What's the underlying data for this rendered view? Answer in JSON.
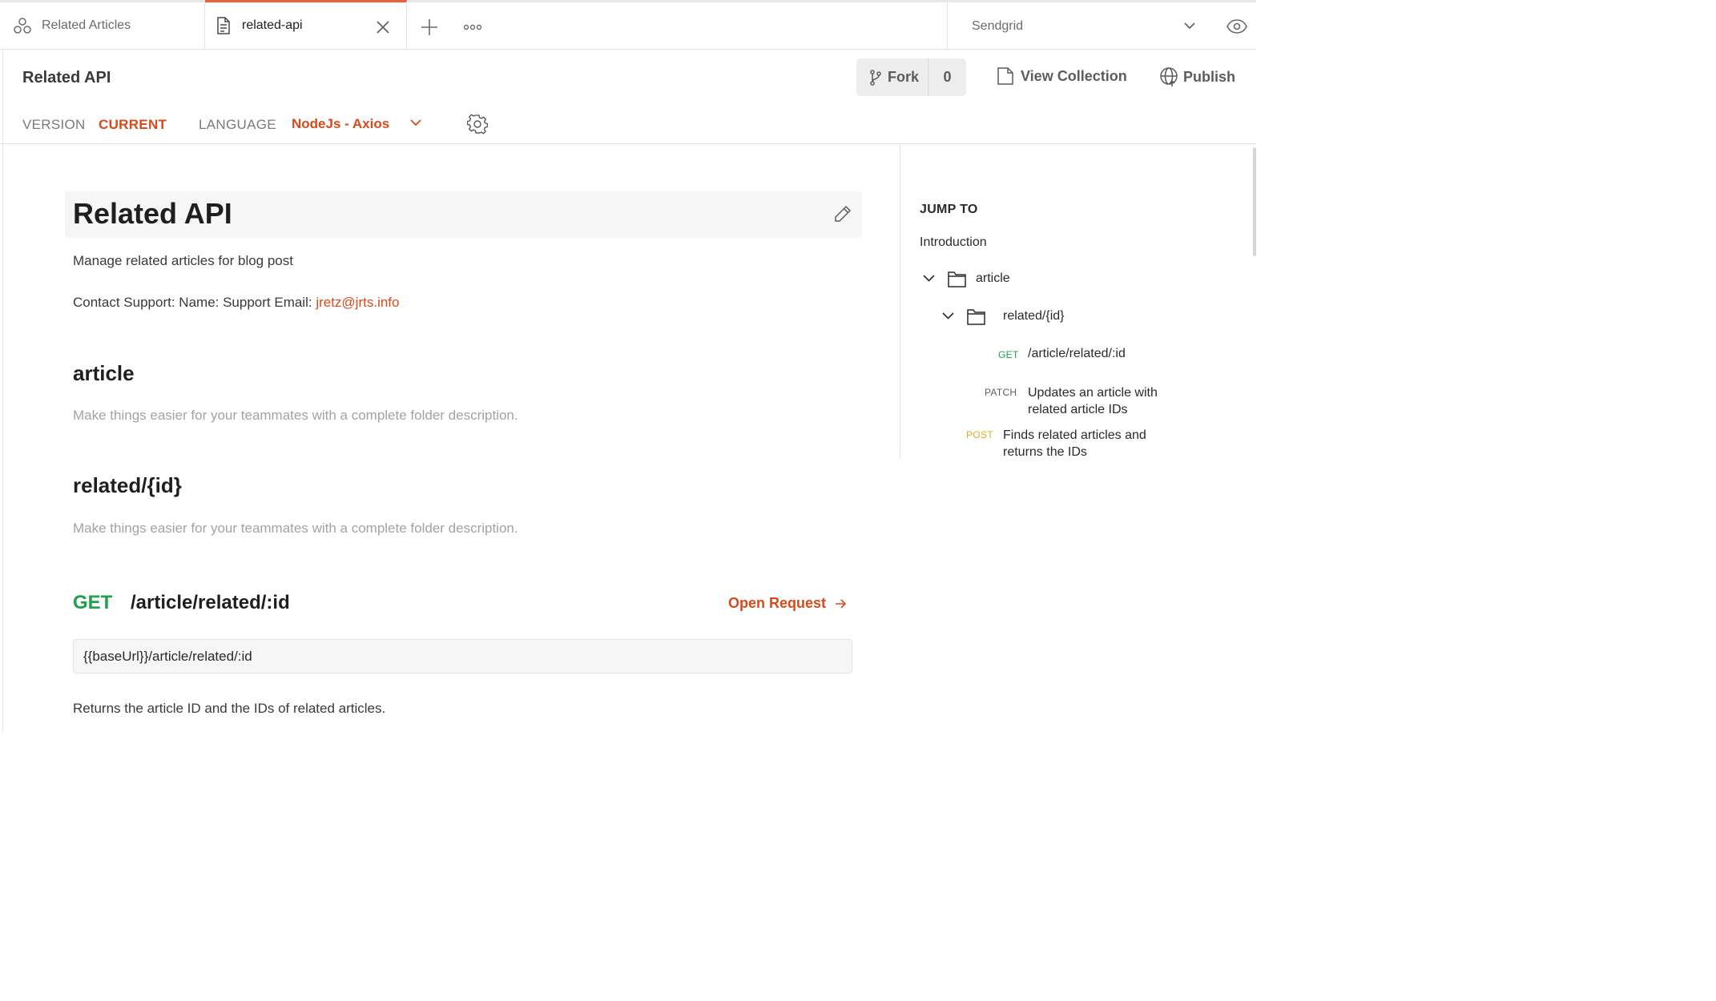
{
  "tabs": [
    {
      "label": "Related Articles",
      "icon": "collection-icon",
      "active": false
    },
    {
      "label": "related-api",
      "icon": "document-icon",
      "active": true
    }
  ],
  "environment": {
    "selected": "Sendgrid"
  },
  "header": {
    "title": "Related API",
    "fork_label": "Fork",
    "fork_count": "0",
    "view_collection_label": "View Collection",
    "publish_label": "Publish"
  },
  "meta": {
    "version_label": "VERSION",
    "version_value": "CURRENT",
    "language_label": "LANGUAGE",
    "language_value": "NodeJs - Axios"
  },
  "doc": {
    "title": "Related API",
    "description": "Manage related articles for blog post",
    "contact_prefix": "Contact Support: Name: Support Email: ",
    "contact_email": "jretz@jrts.info",
    "sections": [
      {
        "heading": "article",
        "description": "Make things easier for your teammates with a complete folder description."
      },
      {
        "heading": "related/{id}",
        "description": "Make things easier for your teammates with a complete folder description."
      }
    ],
    "request": {
      "method": "GET",
      "path": "/article/related/:id",
      "open_label": "Open Request",
      "url": "{{baseUrl}}/article/related/:id",
      "description": "Returns the article ID and the IDs of related articles."
    }
  },
  "jump_to": {
    "title": "JUMP TO",
    "intro": "Introduction",
    "folder": "article",
    "subfolder": "related/{id}",
    "items": [
      {
        "method": "GET",
        "label": "/article/related/:id"
      },
      {
        "method": "PATCH",
        "label": "Updates an article with related article IDs"
      },
      {
        "method": "POST",
        "label": "Finds related articles and returns the IDs"
      }
    ]
  },
  "colors": {
    "accent": "#d9491a",
    "get": "#1aa34a",
    "post": "#e9a722",
    "active_tab_border": "#e8613d"
  }
}
